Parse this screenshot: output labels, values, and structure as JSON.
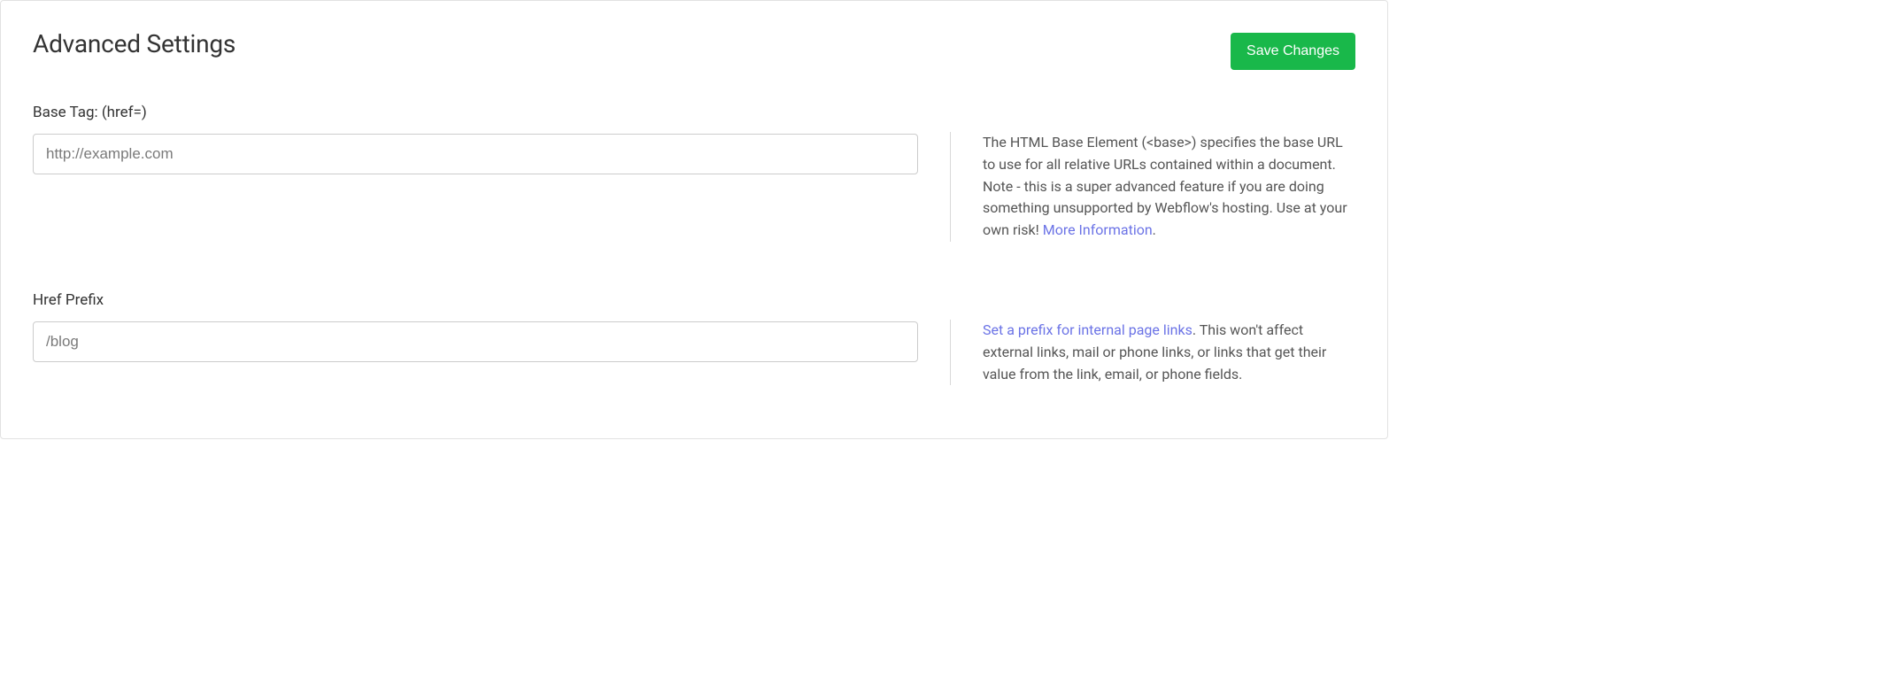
{
  "header": {
    "title": "Advanced Settings",
    "save_label": "Save Changes"
  },
  "base_tag": {
    "label": "Base Tag: (href=)",
    "placeholder": "http://example.com",
    "value": "",
    "help_text": "The HTML Base Element (<base>) specifies the base URL to use for all relative URLs contained within a document. Note - this is a super advanced feature if you are doing something unsupported by Webflow's hosting. Use at your own risk! ",
    "link_text": "More Information",
    "after_link": "."
  },
  "href_prefix": {
    "label": "Href Prefix",
    "placeholder": "/blog",
    "value": "",
    "link_text": "Set a prefix for internal page links",
    "help_text_after": ". This won't affect external links, mail or phone links, or links that get their value from the link, email, or phone fields."
  }
}
